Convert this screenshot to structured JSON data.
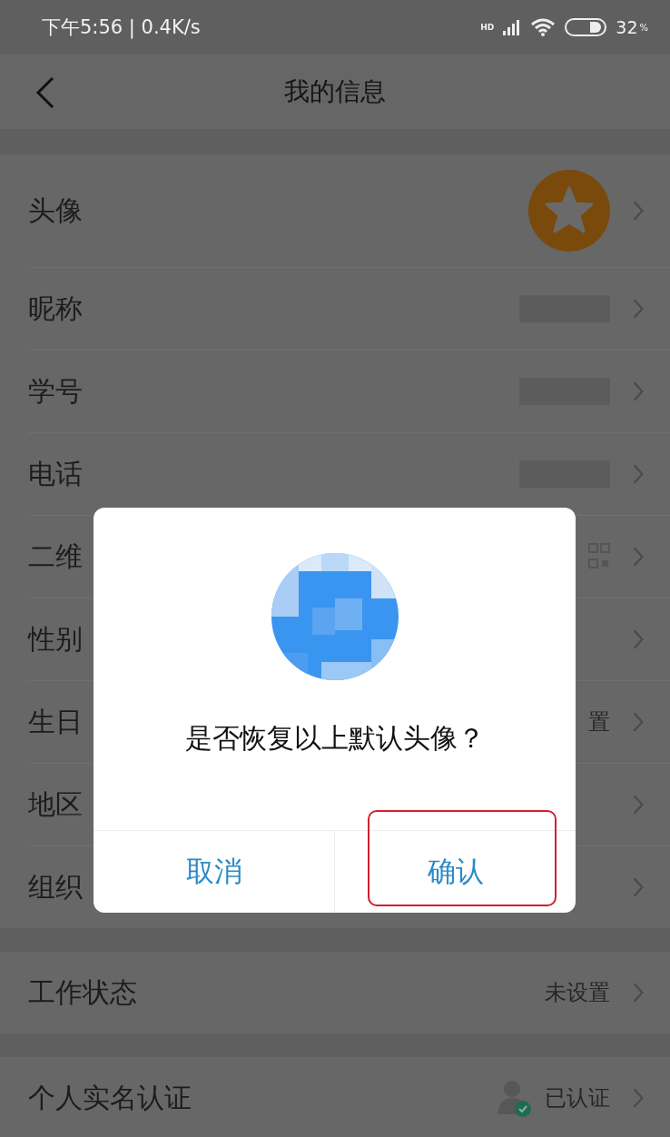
{
  "status_bar": {
    "time": "下午5:56 | 0.4K/s",
    "network": "HD",
    "battery": "32",
    "battery_unit": "%"
  },
  "header": {
    "title": "我的信息"
  },
  "sections": [
    {
      "rows": [
        {
          "label": "头像",
          "kind": "avatar"
        },
        {
          "label": "昵称",
          "kind": "blurred"
        },
        {
          "label": "学号",
          "kind": "blurred"
        },
        {
          "label": "电话",
          "kind": "blurred"
        },
        {
          "label": "二维",
          "kind": "qr"
        },
        {
          "label": "性别",
          "kind": "none"
        },
        {
          "label": "生日",
          "kind": "text",
          "value": "置"
        },
        {
          "label": "地区",
          "kind": "none"
        },
        {
          "label": "组织",
          "kind": "none"
        }
      ]
    },
    {
      "rows": [
        {
          "label": "工作状态",
          "kind": "text",
          "value": "未设置"
        }
      ]
    },
    {
      "rows": [
        {
          "label": "个人实名认证",
          "kind": "verified",
          "value": "已认证"
        }
      ]
    }
  ],
  "dialog": {
    "message": "是否恢复以上默认头像？",
    "buttons": [
      {
        "label": "取消",
        "highlighted": false
      },
      {
        "label": "确认",
        "highlighted": true
      }
    ]
  }
}
